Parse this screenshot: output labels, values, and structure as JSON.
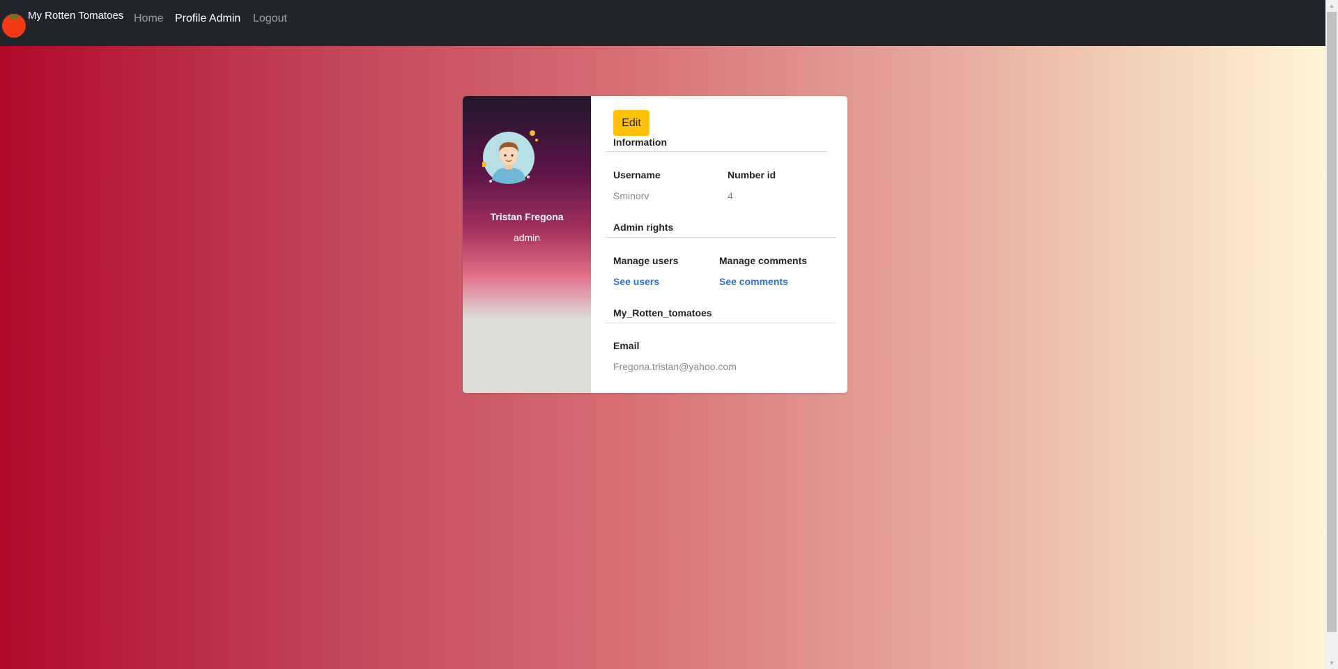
{
  "navbar": {
    "brand": "My Rotten Tomatoes",
    "links": [
      "Home",
      "Profile Admin",
      "Logout"
    ]
  },
  "profile": {
    "name": "Tristan Fregona",
    "role": "admin",
    "edit_label": "Edit",
    "sections": {
      "information": {
        "title": "Information",
        "username_label": "Username",
        "username_value": "Sminorv",
        "id_label": "Number id",
        "id_value": "4"
      },
      "admin_rights": {
        "title": "Admin rights",
        "manage_users_label": "Manage users",
        "manage_users_link": "See users",
        "manage_comments_label": "Manage comments",
        "manage_comments_link": "See comments"
      },
      "site": {
        "title": "My_Rotten_tomatoes",
        "email_label": "Email",
        "email_value": "Fregona.tristan@yahoo.com"
      }
    }
  },
  "colors": {
    "navbar_bg": "#212529",
    "edit_button": "#ffc107",
    "link": "#2e6fd8"
  }
}
